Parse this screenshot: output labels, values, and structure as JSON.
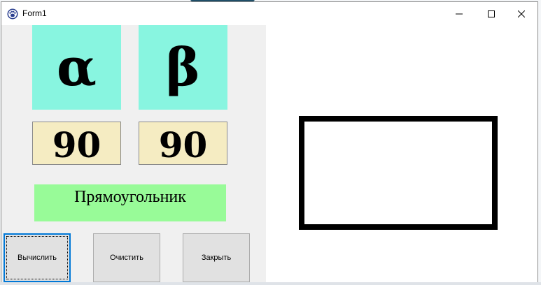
{
  "window": {
    "title": "Form1",
    "icon": "paw-icon",
    "controls": {
      "minimize": "minimize-icon",
      "maximize": "maximize-icon",
      "close": "close-icon"
    }
  },
  "tiles": {
    "alpha_symbol": "α",
    "beta_symbol": "β"
  },
  "fields": {
    "alpha_value": "90",
    "beta_value": "90"
  },
  "result": {
    "shape_name": "Прямоугольник"
  },
  "buttons": {
    "calculate": "Вычислить",
    "clear": "Очистить",
    "close": "Закрыть"
  },
  "colors": {
    "tile_bg": "#88f5e0",
    "field_bg": "#f5ecc2",
    "result_bg": "#98fb98",
    "focus_border": "#0078d7"
  }
}
